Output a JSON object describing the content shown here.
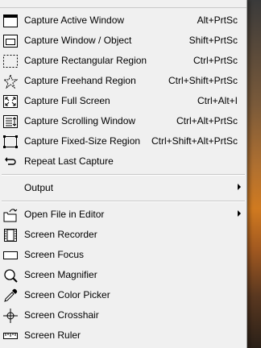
{
  "menu": {
    "capture_items": [
      {
        "label": "Capture Active Window",
        "shortcut": "Alt+PrtSc",
        "icon": "active-window-icon"
      },
      {
        "label": "Capture Window / Object",
        "shortcut": "Shift+PrtSc",
        "icon": "window-object-icon"
      },
      {
        "label": "Capture Rectangular Region",
        "shortcut": "Ctrl+PrtSc",
        "icon": "rectangular-region-icon"
      },
      {
        "label": "Capture Freehand Region",
        "shortcut": "Ctrl+Shift+PrtSc",
        "icon": "freehand-region-icon"
      },
      {
        "label": "Capture Full Screen",
        "shortcut": "Ctrl+Alt+I",
        "icon": "full-screen-icon"
      },
      {
        "label": "Capture Scrolling Window",
        "shortcut": "Ctrl+Alt+PrtSc",
        "icon": "scrolling-window-icon"
      },
      {
        "label": "Capture Fixed-Size Region",
        "shortcut": "Ctrl+Shift+Alt+PrtSc",
        "icon": "fixed-size-region-icon"
      },
      {
        "label": "Repeat Last Capture",
        "shortcut": "",
        "icon": "repeat-capture-icon"
      }
    ],
    "output": {
      "label": "Output"
    },
    "tool_items": [
      {
        "label": "Open File in Editor",
        "icon": "open-file-icon",
        "submenu": true
      },
      {
        "label": "Screen Recorder",
        "icon": "film-icon"
      },
      {
        "label": "Screen Focus",
        "icon": "focus-rectangle-icon"
      },
      {
        "label": "Screen Magnifier",
        "icon": "magnifier-icon"
      },
      {
        "label": "Screen Color Picker",
        "icon": "eyedropper-icon"
      },
      {
        "label": "Screen Crosshair",
        "icon": "crosshair-icon"
      },
      {
        "label": "Screen Ruler",
        "icon": "ruler-icon"
      }
    ]
  }
}
